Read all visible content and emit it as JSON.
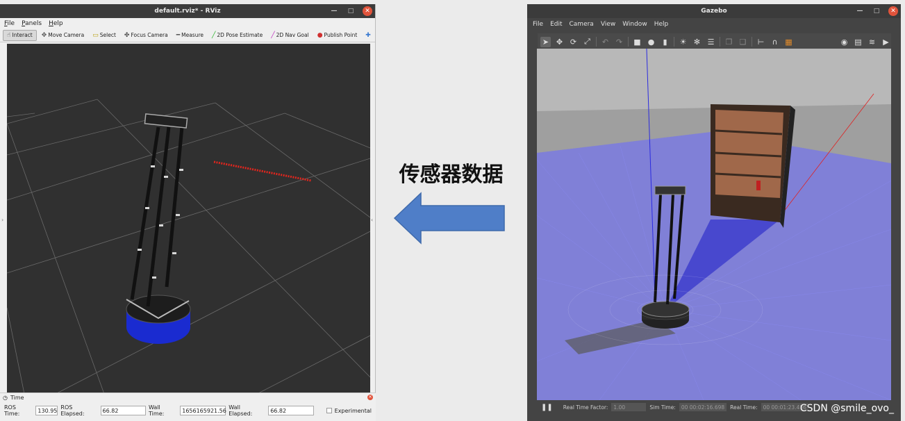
{
  "rviz": {
    "title": "default.rviz* - RViz",
    "menu": [
      "File",
      "Panels",
      "Help"
    ],
    "tools": [
      {
        "label": "Interact",
        "icon": "interact-icon",
        "glyph": "☝"
      },
      {
        "label": "Move Camera",
        "icon": "move-camera-icon",
        "glyph": "✥"
      },
      {
        "label": "Select",
        "icon": "select-icon",
        "glyph": "▭"
      },
      {
        "label": "Focus Camera",
        "icon": "focus-camera-icon",
        "glyph": "✤"
      },
      {
        "label": "Measure",
        "icon": "measure-icon",
        "glyph": "━"
      },
      {
        "label": "2D Pose Estimate",
        "icon": "pose-estimate-icon",
        "glyph": "╱"
      },
      {
        "label": "2D Nav Goal",
        "icon": "nav-goal-icon",
        "glyph": "╱"
      },
      {
        "label": "Publish Point",
        "icon": "publish-point-icon",
        "glyph": "●"
      }
    ],
    "time_panel": {
      "title": "Time",
      "ros_time_label": "ROS Time:",
      "ros_time": "130.95",
      "ros_elapsed_label": "ROS Elapsed:",
      "ros_elapsed": "66.82",
      "wall_time_label": "Wall Time:",
      "wall_time": "1656165921.56",
      "wall_elapsed_label": "Wall Elapsed:",
      "wall_elapsed": "66.82",
      "experimental_label": "Experimental"
    }
  },
  "annotation": {
    "text": "传感器数据",
    "arrow_color": "#4f7ec8"
  },
  "gazebo": {
    "title": "Gazebo",
    "menu": [
      "File",
      "Edit",
      "Camera",
      "View",
      "Window",
      "Help"
    ],
    "status": {
      "real_time_factor_label": "Real Time Factor:",
      "real_time_factor": "1.00",
      "sim_time_label": "Sim Time:",
      "sim_time": "00 00:02:16.698",
      "real_time_label": "Real Time:",
      "real_time": "00 00:01:23.456"
    },
    "watermark": "CSDN @smile_ovo_"
  },
  "colors": {
    "laser_red": "#e0261e",
    "robot_base_blue": "#1a2bd0",
    "laser_blue": "#5a5aff",
    "bookshelf": "#8a5a3a"
  }
}
